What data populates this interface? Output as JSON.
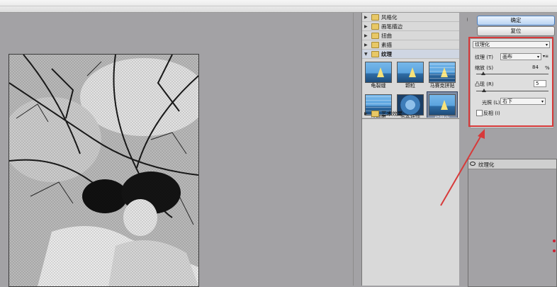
{
  "gallery": {
    "categories": [
      {
        "label": "风格化",
        "open": false
      },
      {
        "label": "画笔描边",
        "open": false
      },
      {
        "label": "扭曲",
        "open": false
      },
      {
        "label": "素描",
        "open": false
      },
      {
        "label": "纹理",
        "open": true
      }
    ],
    "texture_filters": [
      "龟裂缝",
      "颗粒",
      "马赛克拼贴",
      "拼缀图",
      "染色玻璃",
      "纹理化"
    ],
    "selected_filter": "纹理化",
    "after_category": {
      "label": "艺术效果",
      "open": false
    }
  },
  "buttons": {
    "ok": "确定",
    "reset": "复位"
  },
  "params": {
    "filter_select": "纹理化",
    "texture_label": "纹理 (T)",
    "texture_value": "画布",
    "texture_menu": "▾≡",
    "scaling_label": "缩放 (S)",
    "scaling_value": "84",
    "scaling_unit": "%",
    "relief_label": "凸现 (R)",
    "relief_value": "5",
    "light_label": "光照 (L)",
    "light_value": "右下",
    "invert_label": "反相 (I)",
    "invert_checked": false
  },
  "layers": {
    "current": "纹理化"
  },
  "colors": {
    "highlight": "#d73a3a",
    "arrow": "#d73a3a"
  }
}
